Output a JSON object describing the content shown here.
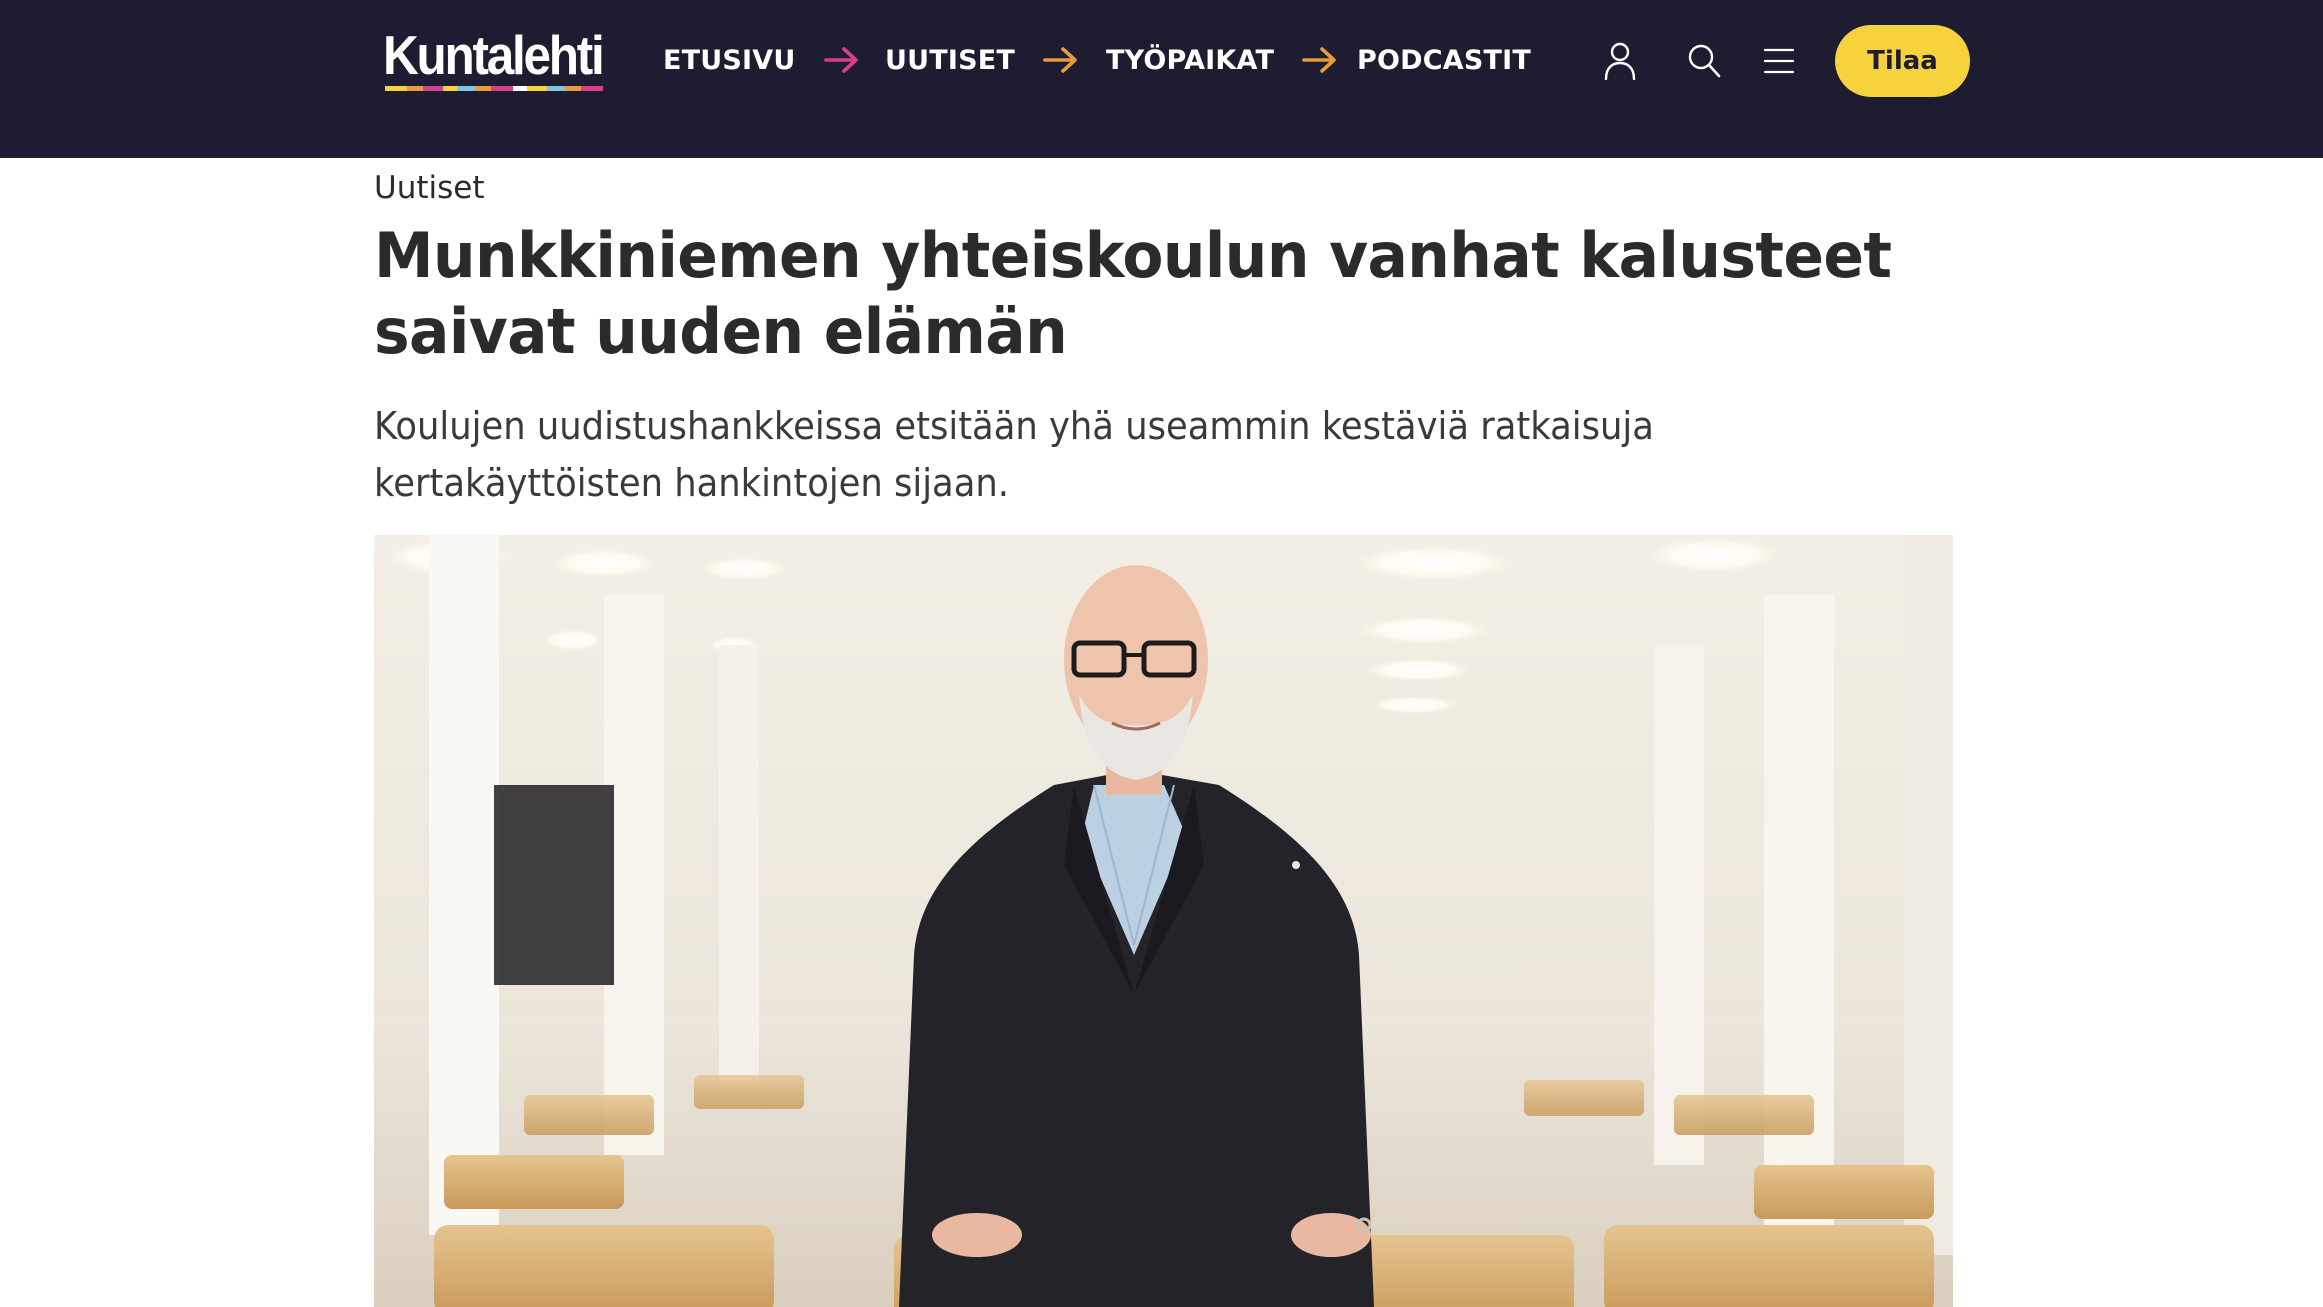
{
  "header": {
    "logo_text": "Kuntalehti",
    "nav": [
      {
        "label": "ETUSIVU",
        "arrow_color": "#d6408a"
      },
      {
        "label": "UUTISET",
        "arrow_color": "#e89a3c"
      },
      {
        "label": "TYÖPAIKAT",
        "arrow_color": "#e89a3c"
      },
      {
        "label": "PODCASTIT"
      }
    ],
    "icons": [
      "user-icon",
      "search-icon",
      "menu-icon"
    ],
    "subscribe_label": "Tilaa",
    "colors": {
      "background": "#1d1c30",
      "subscribe_button": "#f6d23c"
    }
  },
  "article": {
    "category": "Uutiset",
    "title": "Munkkiniemen yhteiskoulun vanhat kalusteet saivat uuden elämän",
    "lead": "Koulujen uudistushankkeissa etsitään yhä useammin kestäviä ratkaisuja kertakäyttöisten hankintojen sijaan."
  }
}
